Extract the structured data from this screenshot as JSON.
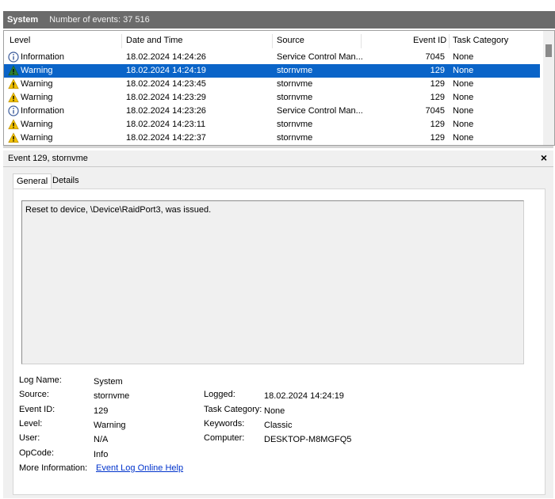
{
  "titlebar": {
    "log": "System",
    "count_text": "Number of events: 37 516",
    "bg": "#6b6b6b"
  },
  "grid": {
    "headers": {
      "level": "Level",
      "date": "Date and Time",
      "source": "Source",
      "event_id": "Event ID",
      "task": "Task Category"
    },
    "rows": [
      {
        "icon": "information-icon",
        "level": "Information",
        "date": "18.02.2024 14:24:26",
        "source": "Service Control Man...",
        "event_id": "7045",
        "task": "None",
        "selected": false
      },
      {
        "icon": "warning-icon",
        "level": "Warning",
        "date": "18.02.2024 14:24:19",
        "source": "stornvme",
        "event_id": "129",
        "task": "None",
        "selected": true
      },
      {
        "icon": "warning-icon",
        "level": "Warning",
        "date": "18.02.2024 14:23:45",
        "source": "stornvme",
        "event_id": "129",
        "task": "None",
        "selected": false
      },
      {
        "icon": "warning-icon",
        "level": "Warning",
        "date": "18.02.2024 14:23:29",
        "source": "stornvme",
        "event_id": "129",
        "task": "None",
        "selected": false
      },
      {
        "icon": "information-icon",
        "level": "Information",
        "date": "18.02.2024 14:23:26",
        "source": "Service Control Man...",
        "event_id": "7045",
        "task": "None",
        "selected": false
      },
      {
        "icon": "warning-icon",
        "level": "Warning",
        "date": "18.02.2024 14:23:11",
        "source": "stornvme",
        "event_id": "129",
        "task": "None",
        "selected": false
      },
      {
        "icon": "warning-icon",
        "level": "Warning",
        "date": "18.02.2024 14:22:37",
        "source": "stornvme",
        "event_id": "129",
        "task": "None",
        "selected": false
      }
    ],
    "selection_color": "#0a64c8"
  },
  "detail": {
    "title": "Event 129, stornvme",
    "close_glyph": "×",
    "tabs": {
      "general": "General",
      "details": "Details"
    },
    "message": "Reset to device, \\Device\\RaidPort3, was issued.",
    "labels": {
      "log_name": "Log Name:",
      "source": "Source:",
      "event_id": "Event ID:",
      "level": "Level:",
      "user": "User:",
      "opcode": "OpCode:",
      "more_info": "More Information:",
      "logged": "Logged:",
      "task_category": "Task Category:",
      "keywords": "Keywords:",
      "computer": "Computer:"
    },
    "values": {
      "log_name": "System",
      "source": "stornvme",
      "event_id": "129",
      "level": "Warning",
      "user": "N/A",
      "opcode": "Info",
      "more_info_link": "Event Log Online Help",
      "logged": "18.02.2024 14:24:19",
      "task_category": "None",
      "keywords": "Classic",
      "computer": "DESKTOP-M8MGFQ5"
    }
  }
}
